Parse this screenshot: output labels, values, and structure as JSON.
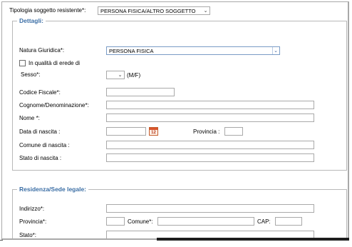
{
  "header": {
    "tipologia_label": "Tipologia soggetto resistente*:",
    "tipologia_value": "PERSONA FISICA/ALTRO SOGGETTO"
  },
  "dettagli": {
    "legend": "Dettagli:",
    "natura_label": "Natura Giuridica*:",
    "natura_value": "PERSONA FISICA",
    "erede_label": "In qualità di erede di",
    "erede_checked": false,
    "sesso_label": "Sesso*:",
    "sesso_value": "",
    "sesso_hint": "(M/F)",
    "codice_fiscale_label": "Codice Fiscale*:",
    "codice_fiscale_value": "",
    "cognome_label": "Cognome/Denominazione*:",
    "cognome_value": "",
    "nome_label": "Nome *:",
    "nome_value": "",
    "data_nascita_label": "Data di nascita :",
    "data_nascita_value": "",
    "calendar_text": "12",
    "provincia_label": "Provincia :",
    "provincia_value": "",
    "comune_nascita_label": "Comune di nascita :",
    "comune_nascita_value": "",
    "stato_nascita_label": "Stato di nascita :",
    "stato_nascita_value": ""
  },
  "residenza": {
    "legend": "Residenza/Sede legale:",
    "indirizzo_label": "Indirizzo*:",
    "indirizzo_value": "",
    "provincia_label": "Provincia*:",
    "provincia_value": "",
    "comune_label": "Comune*:",
    "comune_value": "",
    "cap_label": "CAP:",
    "cap_value": "",
    "stato_label": "Stato*:",
    "stato_value": ""
  },
  "icons": {
    "dropdown": "chevron-down-icon",
    "calendar": "calendar-icon"
  },
  "colors": {
    "legend": "#3b6ea5",
    "calendar_accent": "#d9542c"
  }
}
